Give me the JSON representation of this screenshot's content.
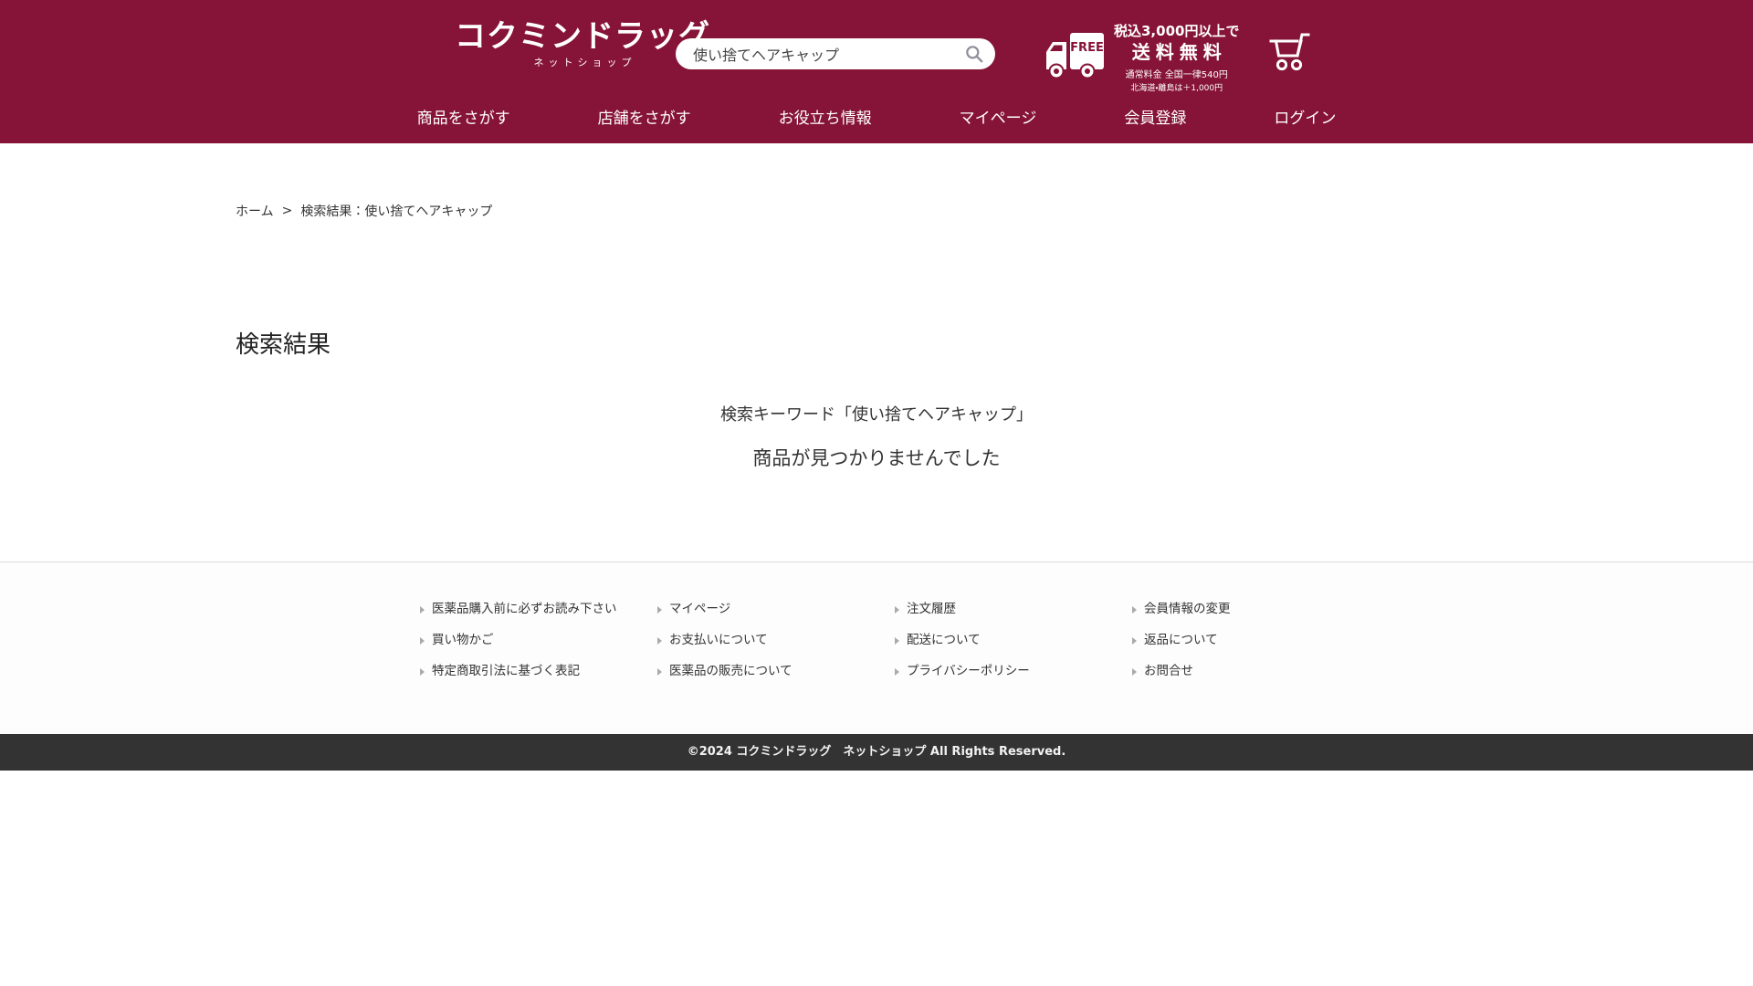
{
  "theme": {
    "brand_color": "#861338",
    "copyright_bar_color": "#333333",
    "link_color": "#333333",
    "separator_color": "#dcdcdc"
  },
  "header": {
    "logo": {
      "title": "コクミンドラッグ",
      "subtitle": "ネットショップ"
    },
    "search": {
      "value": "使い捨てヘアキャップ",
      "icon": "search-icon"
    },
    "shipping": {
      "truck_badge": "FREE",
      "line1": "税込3,000円以上で",
      "line2": "送料無料",
      "line3": "通常料金 全国一律540円",
      "line4": "北海道・離島は＋1,000円"
    },
    "cart_icon": "cart-icon",
    "nav": [
      "商品をさがす",
      "店舗をさがす",
      "お役立ち情報",
      "マイページ",
      "会員登録",
      "ログイン"
    ]
  },
  "breadcrumb": {
    "home": "ホーム",
    "separator": ">",
    "current": "検索結果：使い捨てヘアキャップ"
  },
  "main": {
    "title": "検索結果",
    "keyword_line": "検索キーワード「使い捨てヘアキャップ」",
    "no_results": "商品が見つかりませんでした"
  },
  "footer": {
    "columns": [
      [
        "医薬品購入前に必ずお読み下さい",
        "買い物かご",
        "特定商取引法に基づく表記"
      ],
      [
        "マイページ",
        "お支払いについて",
        "医薬品の販売について"
      ],
      [
        "注文履歴",
        "配送について",
        "プライバシーポリシー"
      ],
      [
        "会員情報の変更",
        "返品について",
        "お問合せ"
      ]
    ],
    "copyright": "©2024 コクミンドラッグ　ネットショップ All Rights Reserved."
  }
}
